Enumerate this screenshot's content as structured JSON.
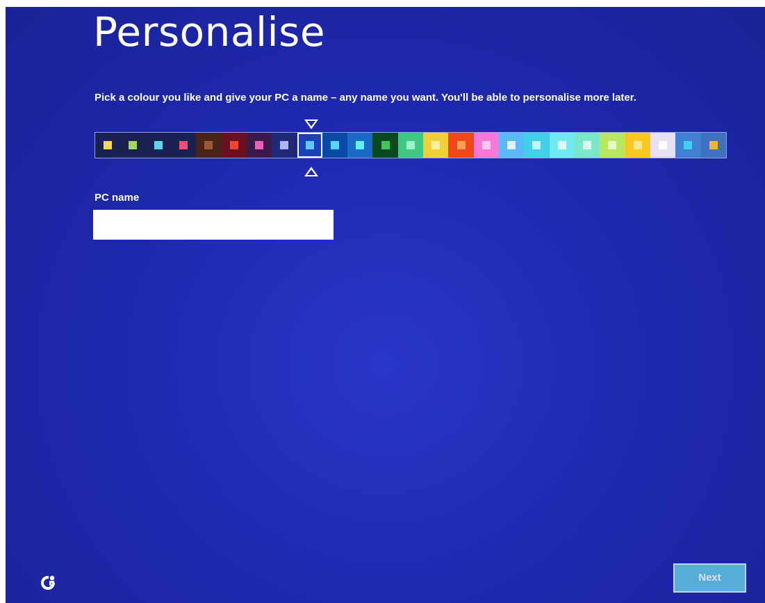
{
  "page": {
    "title": "Personalise",
    "subtitle": "Pick a colour you like and give your PC a name – any name you want. You'll be able to personalise more later."
  },
  "colour_picker": {
    "selected_index": 8,
    "swatches": [
      {
        "background": "#1b2150",
        "chip": "#f5d860"
      },
      {
        "background": "#1b2150",
        "chip": "#9cd860"
      },
      {
        "background": "#1b2150",
        "chip": "#5ad4f0"
      },
      {
        "background": "#1b2150",
        "chip": "#e8507a"
      },
      {
        "background": "#4a2418",
        "chip": "#9a5a30"
      },
      {
        "background": "#6a1020",
        "chip": "#f04830"
      },
      {
        "background": "#3a1a4a",
        "chip": "#e860b8"
      },
      {
        "background": "#1e2a78",
        "chip": "#b0b4f0"
      },
      {
        "background": "#1c40b8",
        "chip": "#60c8f8"
      },
      {
        "background": "#0a4aa8",
        "chip": "#58d8f8"
      },
      {
        "background": "#1a6ac8",
        "chip": "#60f0f8"
      },
      {
        "background": "#0a4a20",
        "chip": "#40c860"
      },
      {
        "background": "#40c880",
        "chip": "#9cf0d0"
      },
      {
        "background": "#f0d038",
        "chip": "#f8f0a0"
      },
      {
        "background": "#f04818",
        "chip": "#f8a058"
      },
      {
        "background": "#f878d8",
        "chip": "#f8c8f0"
      },
      {
        "background": "#58b8f8",
        "chip": "#e0f0ff"
      },
      {
        "background": "#40d0e8",
        "chip": "#c0f4f8"
      },
      {
        "background": "#70e8f0",
        "chip": "#e0fbfb"
      },
      {
        "background": "#78e8c8",
        "chip": "#d8f8ec"
      },
      {
        "background": "#b8e860",
        "chip": "#e8f8c0"
      },
      {
        "background": "#f8c820",
        "chip": "#f8e890"
      },
      {
        "background": "#e8e0f0",
        "chip": "#ffffff"
      },
      {
        "background": "#4080d0",
        "chip": "#40d0f0"
      },
      {
        "background": "#4070c0",
        "chip": "#f8b040"
      }
    ]
  },
  "pc_name": {
    "label": "PC name",
    "value": "",
    "placeholder": ""
  },
  "footer": {
    "ease_of_access_icon": "ease-of-access-icon",
    "next_label": "Next"
  }
}
